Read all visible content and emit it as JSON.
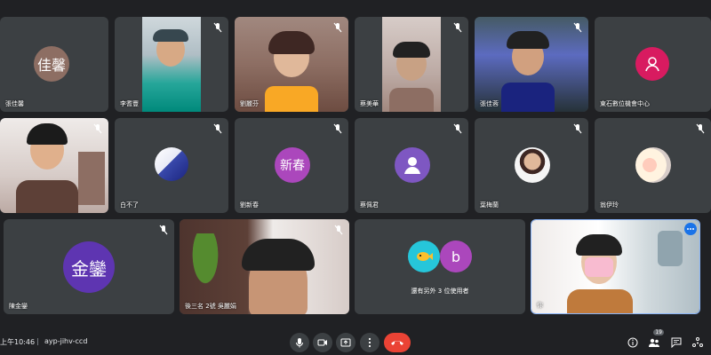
{
  "tiles": [
    {
      "name": "張佳馨",
      "initials": "佳馨"
    },
    {
      "name": "李耆豐"
    },
    {
      "name": "劉麗芬"
    },
    {
      "name": "蔡美華"
    },
    {
      "name": "張佳蓉"
    },
    {
      "name": "東石數位機會中心"
    },
    {
      "name": ""
    },
    {
      "name": "白不了"
    },
    {
      "name": "劉新春",
      "initials": "新春"
    },
    {
      "name": "蔡佩君"
    },
    {
      "name": "葉梅蘭"
    },
    {
      "name": "翁伊玲"
    },
    {
      "name": "陳金鑾",
      "initials": "金鑾"
    },
    {
      "name": "後三名 2號 吳麗娟"
    },
    {
      "name": "還有另外 3 位使用者",
      "initials": "b"
    },
    {
      "name": "你"
    }
  ],
  "bottom_bar": {
    "time": "上午10:46",
    "separator": "|",
    "meeting_code": "ayp-jihv-ccd",
    "people_count": "19"
  },
  "colors": {
    "accent": "#8ab4f8",
    "end_call": "#ea4335",
    "tile_bg": "#3c4043",
    "page_bg": "#202124"
  }
}
